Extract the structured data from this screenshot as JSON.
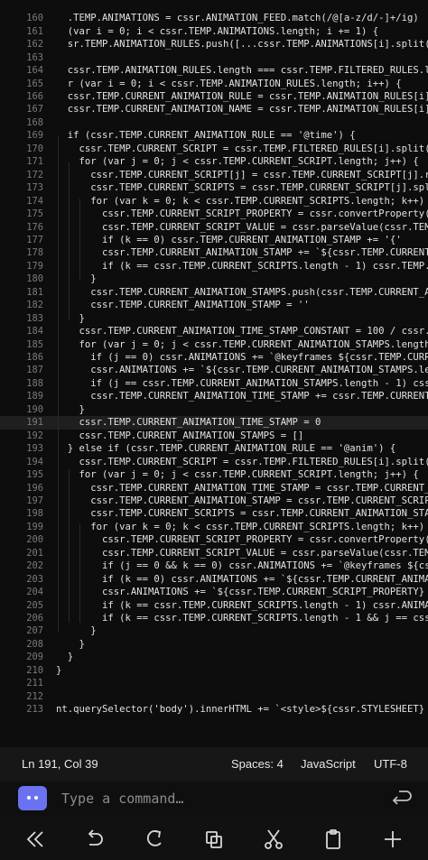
{
  "editor": {
    "current_line": "191",
    "lines": [
      {
        "n": "160",
        "t": "  .TEMP.ANIMATIONS = cssr.ANIMATION_FEED.match(/@[a-z/d/-]+/ig)"
      },
      {
        "n": "161",
        "t": "  (var i = 0; i < cssr.TEMP.ANIMATIONS.length; i += 1) {"
      },
      {
        "n": "162",
        "t": "  sr.TEMP.ANIMATION_RULES.push([...cssr.TEMP.ANIMATIONS[i].split('-"
      },
      {
        "n": "163",
        "t": ""
      },
      {
        "n": "164",
        "t": "  cssr.TEMP.ANIMATION_RULES.length === cssr.TEMP.FILTERED_RULES.len"
      },
      {
        "n": "165",
        "t": "  r (var i = 0; i < cssr.TEMP.ANIMATION_RULES.length; i++) {"
      },
      {
        "n": "166",
        "t": "  cssr.TEMP.CURRENT_ANIMATION_RULE = cssr.TEMP.ANIMATION_RULES[i][0"
      },
      {
        "n": "167",
        "t": "  cssr.TEMP.CURRENT_ANIMATION_NAME = cssr.TEMP.ANIMATION_RULES[i][1"
      },
      {
        "n": "168",
        "t": ""
      },
      {
        "n": "169",
        "t": "  if (cssr.TEMP.CURRENT_ANIMATION_RULE == '@time') {"
      },
      {
        "n": "170",
        "t": "    cssr.TEMP.CURRENT_SCRIPT = cssr.TEMP.FILTERED_RULES[i].split(']"
      },
      {
        "n": "171",
        "t": "    for (var j = 0; j < cssr.TEMP.CURRENT_SCRIPT.length; j++) {"
      },
      {
        "n": "172",
        "t": "      cssr.TEMP.CURRENT_SCRIPT[j] = cssr.TEMP.CURRENT_SCRIPT[j].rep"
      },
      {
        "n": "173",
        "t": "      cssr.TEMP.CURRENT_SCRIPTS = cssr.TEMP.CURRENT_SCRIPT[j].split"
      },
      {
        "n": "174",
        "t": "      for (var k = 0; k < cssr.TEMP.CURRENT_SCRIPTS.length; k++) {"
      },
      {
        "n": "175",
        "t": "        cssr.TEMP.CURRENT_SCRIPT_PROPERTY = cssr.convertProperty(cs"
      },
      {
        "n": "176",
        "t": "        cssr.TEMP.CURRENT_SCRIPT_VALUE = cssr.parseValue(cssr.TEMP."
      },
      {
        "n": "177",
        "t": "        if (k == 0) cssr.TEMP.CURRENT_ANIMATION_STAMP += '{'"
      },
      {
        "n": "178",
        "t": "        cssr.TEMP.CURRENT_ANIMATION_STAMP += `${cssr.TEMP.CURRENT_S"
      },
      {
        "n": "179",
        "t": "        if (k == cssr.TEMP.CURRENT_SCRIPTS.length - 1) cssr.TEMP.CU"
      },
      {
        "n": "180",
        "t": "      }"
      },
      {
        "n": "181",
        "t": "      cssr.TEMP.CURRENT_ANIMATION_STAMPS.push(cssr.TEMP.CURRENT_ANI"
      },
      {
        "n": "182",
        "t": "      cssr.TEMP.CURRENT_ANIMATION_STAMP = ''"
      },
      {
        "n": "183",
        "t": "    }"
      },
      {
        "n": "184",
        "t": "    cssr.TEMP.CURRENT_ANIMATION_TIME_STAMP_CONSTANT = 100 / cssr.TE"
      },
      {
        "n": "185",
        "t": "    for (var j = 0; j < cssr.TEMP.CURRENT_ANIMATION_STAMPS.length;"
      },
      {
        "n": "186",
        "t": "      if (j == 0) cssr.ANIMATIONS += `@keyframes ${cssr.TEMP.CURREN"
      },
      {
        "n": "187",
        "t": "      cssr.ANIMATIONS += `${cssr.TEMP.CURRENT_ANIMATION_STAMPS.leng"
      },
      {
        "n": "188",
        "t": "      if (j == cssr.TEMP.CURRENT_ANIMATION_STAMPS.length - 1) cssr."
      },
      {
        "n": "189",
        "t": "      cssr.TEMP.CURRENT_ANIMATION_TIME_STAMP += cssr.TEMP.CURRENT_A"
      },
      {
        "n": "190",
        "t": "    }"
      },
      {
        "n": "191",
        "t": "    cssr.TEMP.CURRENT_ANIMATION_TIME_STAMP = 0"
      },
      {
        "n": "192",
        "t": "    cssr.TEMP.CURRENT_ANIMATION_STAMPS = []"
      },
      {
        "n": "193",
        "t": "  } else if (cssr.TEMP.CURRENT_ANIMATION_RULE == '@anim') {"
      },
      {
        "n": "194",
        "t": "    cssr.TEMP.CURRENT_SCRIPT = cssr.TEMP.FILTERED_RULES[i].split(']"
      },
      {
        "n": "195",
        "t": "    for (var j = 0; j < cssr.TEMP.CURRENT_SCRIPT.length; j++) {"
      },
      {
        "n": "196",
        "t": "      cssr.TEMP.CURRENT_ANIMATION_TIME_STAMP = cssr.TEMP.CURRENT_SC"
      },
      {
        "n": "197",
        "t": "      cssr.TEMP.CURRENT_ANIMATION_STAMP = cssr.TEMP.CURRENT_SCRIPT["
      },
      {
        "n": "198",
        "t": "      cssr.TEMP.CURRENT_SCRIPTS = cssr.TEMP.CURRENT_ANIMATION_STAMP"
      },
      {
        "n": "199",
        "t": "      for (var k = 0; k < cssr.TEMP.CURRENT_SCRIPTS.length; k++) {"
      },
      {
        "n": "200",
        "t": "        cssr.TEMP.CURRENT_SCRIPT_PROPERTY = cssr.convertProperty(cs"
      },
      {
        "n": "201",
        "t": "        cssr.TEMP.CURRENT_SCRIPT_VALUE = cssr.parseValue(cssr.TEMP."
      },
      {
        "n": "202",
        "t": "        if (j == 0 && k == 0) cssr.ANIMATIONS += `@keyframes ${cssr"
      },
      {
        "n": "203",
        "t": "        if (k == 0) cssr.ANIMATIONS += `${cssr.TEMP.CURRENT_ANIMATI"
      },
      {
        "n": "204",
        "t": "        cssr.ANIMATIONS += `${cssr.TEMP.CURRENT_SCRIPT_PROPERTY} :"
      },
      {
        "n": "205",
        "t": "        if (k == cssr.TEMP.CURRENT_SCRIPTS.length - 1) cssr.ANIMATI"
      },
      {
        "n": "206",
        "t": "        if (k == cssr.TEMP.CURRENT_SCRIPTS.length - 1 && j == cssr."
      },
      {
        "n": "207",
        "t": "      }"
      },
      {
        "n": "208",
        "t": "    }"
      },
      {
        "n": "209",
        "t": "  }"
      },
      {
        "n": "210",
        "t": "}"
      },
      {
        "n": "211",
        "t": ""
      },
      {
        "n": "212",
        "t": ""
      },
      {
        "n": "213",
        "t": "nt.querySelector('body').innerHTML += `<style>${cssr.STYLESHEET}"
      }
    ]
  },
  "status": {
    "position": "Ln 191, Col 39",
    "indent": "Spaces: 4",
    "language": "JavaScript",
    "encoding": "UTF-8"
  },
  "command": {
    "placeholder": "Type a command…"
  },
  "colors": {
    "accent": "#6a72f2",
    "background": "#0d0d0d",
    "current_line": "#1f1f1f"
  },
  "toolbar": {
    "icons": [
      "double-chevron-left-icon",
      "undo-icon",
      "redo-icon",
      "copy-icon",
      "cut-icon",
      "paste-icon",
      "plus-icon"
    ]
  }
}
